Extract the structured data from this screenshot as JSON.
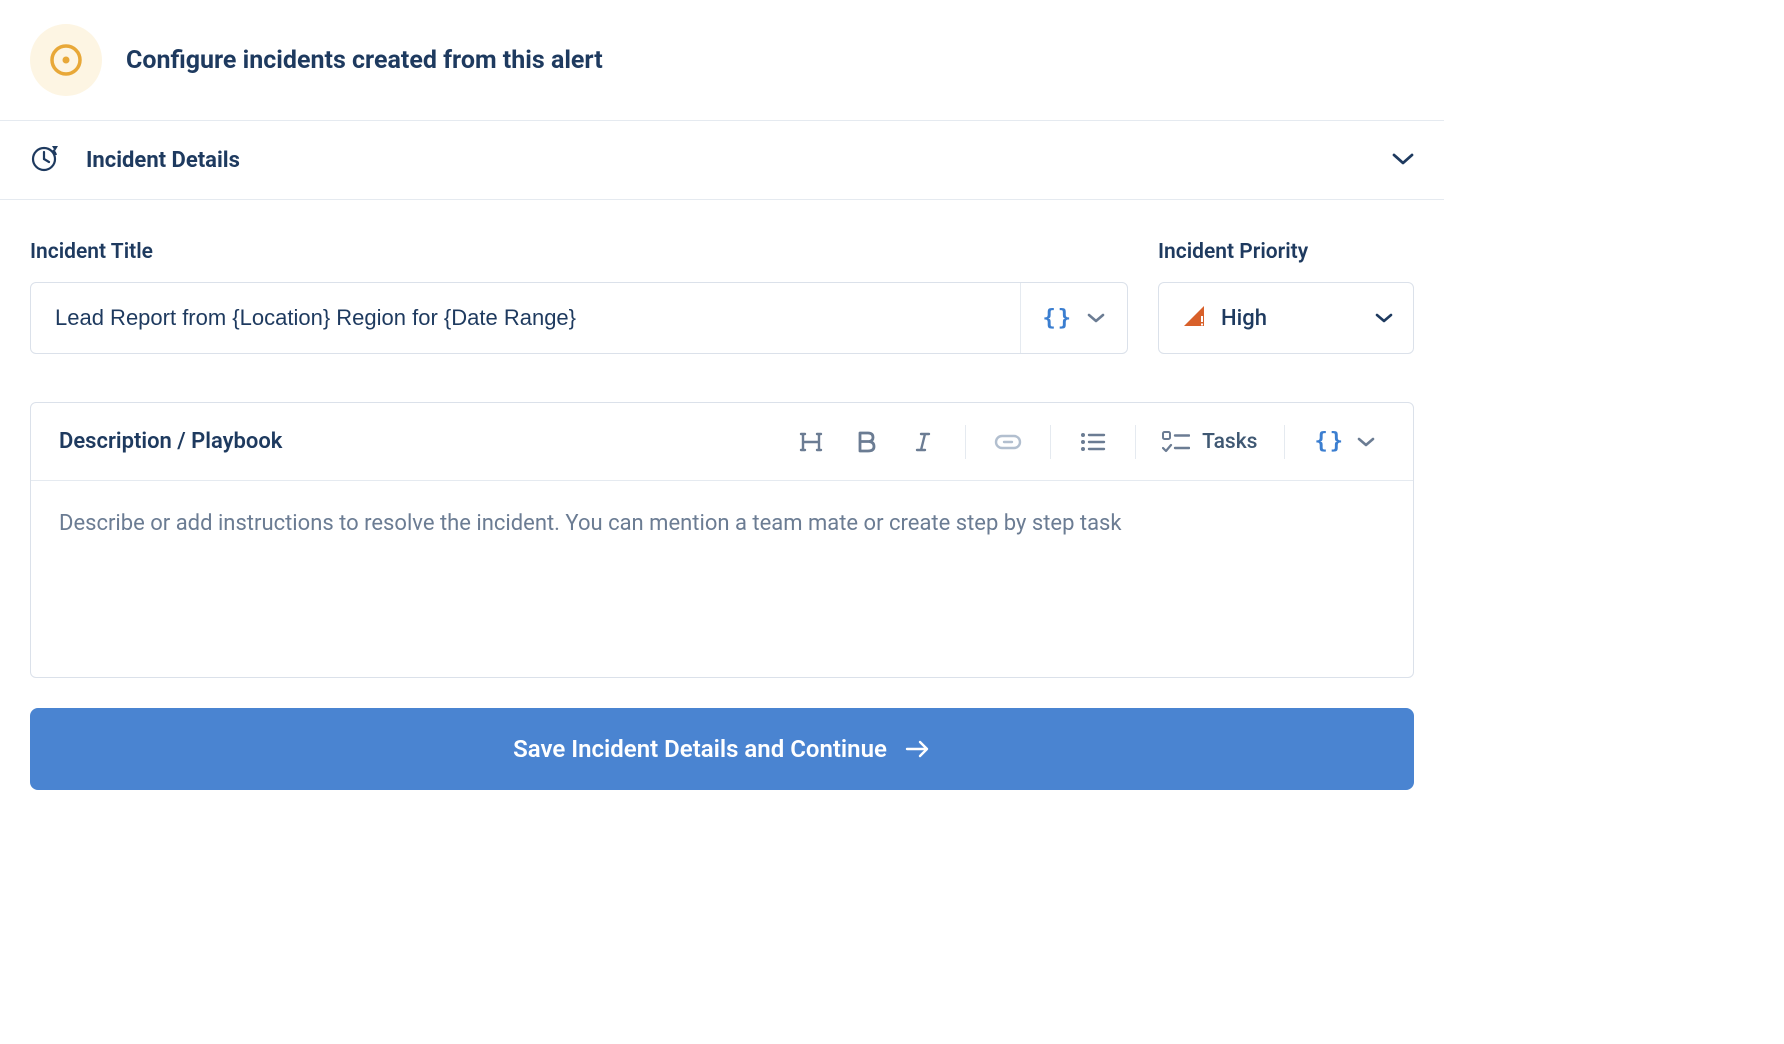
{
  "header": {
    "title": "Configure incidents created from this alert"
  },
  "section": {
    "title": "Incident Details"
  },
  "form": {
    "title_label": "Incident Title",
    "title_value": "Lead Report from {Location} Region for {Date Range}",
    "priority_label": "Incident Priority",
    "priority_value": "High"
  },
  "editor": {
    "label": "Description / Playbook",
    "tasks_label": "Tasks",
    "placeholder": "Describe or add instructions to resolve the incident. You can mention a team mate or create step by step task"
  },
  "actions": {
    "save_label": "Save Incident Details and Continue"
  }
}
